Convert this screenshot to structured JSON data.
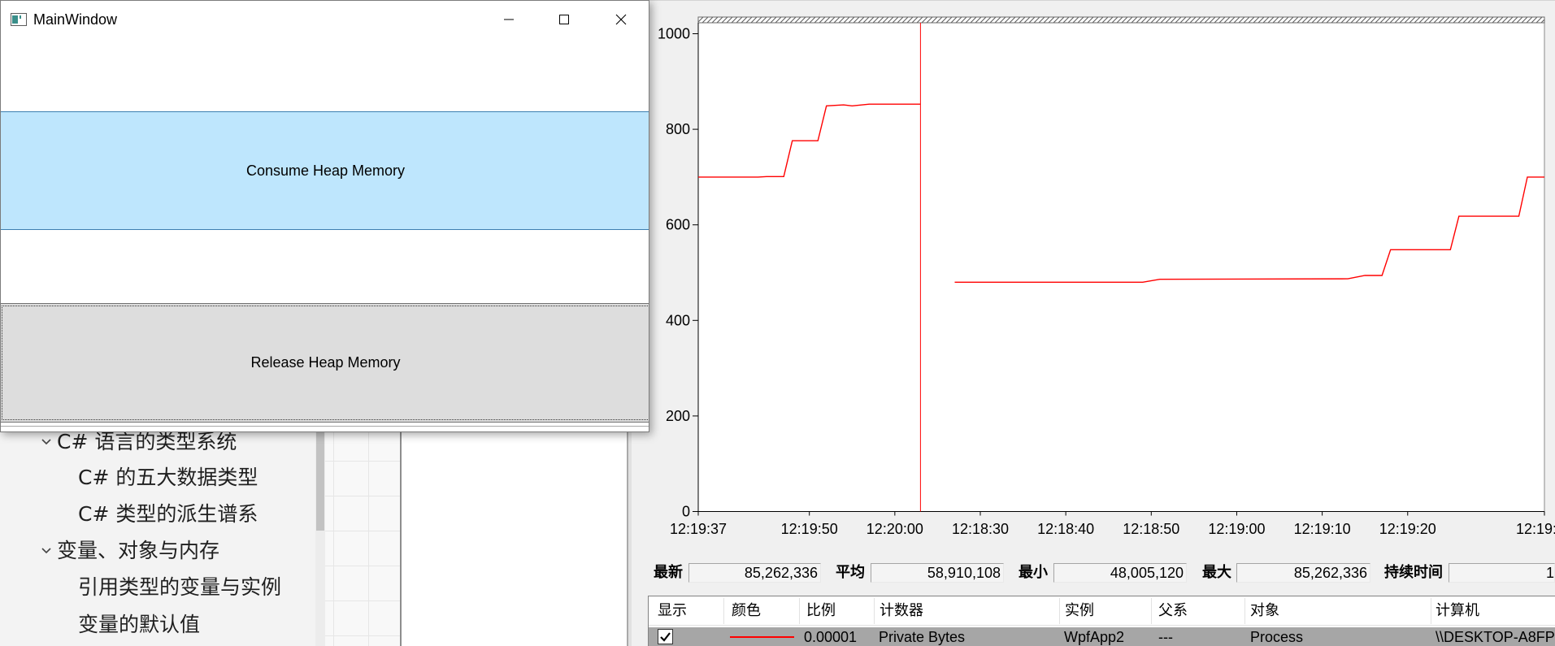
{
  "main_window": {
    "title": "MainWindow",
    "consume_button": "Consume Heap Memory",
    "release_button": "Release Heap Memory",
    "colors": {
      "consume_bg": "#bee6fd",
      "consume_border": "#3c7fb1",
      "release_bg": "#dddddd"
    }
  },
  "doc_tree": {
    "items": [
      {
        "label": "C# 语言的类型系统",
        "level": 0,
        "expanded": true
      },
      {
        "label": "C# 的五大数据类型",
        "level": 1
      },
      {
        "label": "C# 类型的派生谱系",
        "level": 1
      },
      {
        "label": "变量、对象与内存",
        "level": 0,
        "expanded": true
      },
      {
        "label": "引用类型的变量与实例",
        "level": 1
      },
      {
        "label": "变量的默认值",
        "level": 1
      }
    ]
  },
  "perfmon": {
    "stats": [
      {
        "label": "最新",
        "value": "85,262,336"
      },
      {
        "label": "平均",
        "value": "58,910,108"
      },
      {
        "label": "最小",
        "value": "48,005,120"
      },
      {
        "label": "最大",
        "value": "85,262,336"
      },
      {
        "label": "持续时间",
        "value": "1"
      }
    ],
    "counter_table": {
      "columns": [
        "显示",
        "颜色",
        "比例",
        "计数器",
        "实例",
        "父系",
        "对象",
        "计算机"
      ],
      "rows": [
        {
          "show": true,
          "color": "#ff0000",
          "scale": "0.00001",
          "counter": "Private Bytes",
          "instance": "WpfApp2",
          "parent": "---",
          "object": "Process",
          "computer": "\\\\DESKTOP-A8FP"
        }
      ]
    }
  },
  "chart_data": {
    "type": "line",
    "title": "",
    "xlabel": "",
    "ylabel": "",
    "ylim": [
      0,
      1000
    ],
    "y_ticks": [
      1000,
      800,
      600,
      400,
      200,
      0
    ],
    "x_tick_labels": [
      "12:19:37",
      "12:19:50",
      "12:20:00",
      "12:18:30",
      "12:18:40",
      "12:18:50",
      "12:19:00",
      "12:19:10",
      "12:19:20",
      "12:19:"
    ],
    "grid": false,
    "series": [
      {
        "color": "#ff0000",
        "points": [
          [
            "12:18:27",
            480
          ],
          [
            "12:18:49",
            480
          ],
          [
            "12:18:51",
            486
          ],
          [
            "12:19:13",
            487
          ],
          [
            "12:19:15",
            494
          ],
          [
            "12:19:17",
            494
          ],
          [
            "12:19:18",
            548
          ],
          [
            "12:19:25",
            548
          ],
          [
            "12:19:26",
            618
          ],
          [
            "12:19:33",
            618
          ],
          [
            "12:19:34",
            700
          ],
          [
            "12:19:36",
            700
          ],
          [
            "12:19:37",
            700
          ],
          [
            "12:19:44",
            700
          ],
          [
            "12:19:45",
            701
          ],
          [
            "12:19:47",
            701
          ],
          [
            "12:19:48",
            776
          ],
          [
            "12:19:51",
            776
          ],
          [
            "12:19:52",
            849
          ],
          [
            "12:19:54",
            851
          ],
          [
            "12:19:55",
            849
          ],
          [
            "12:19:57",
            852.6
          ],
          [
            "12:20:03",
            852.6
          ]
        ]
      }
    ]
  }
}
